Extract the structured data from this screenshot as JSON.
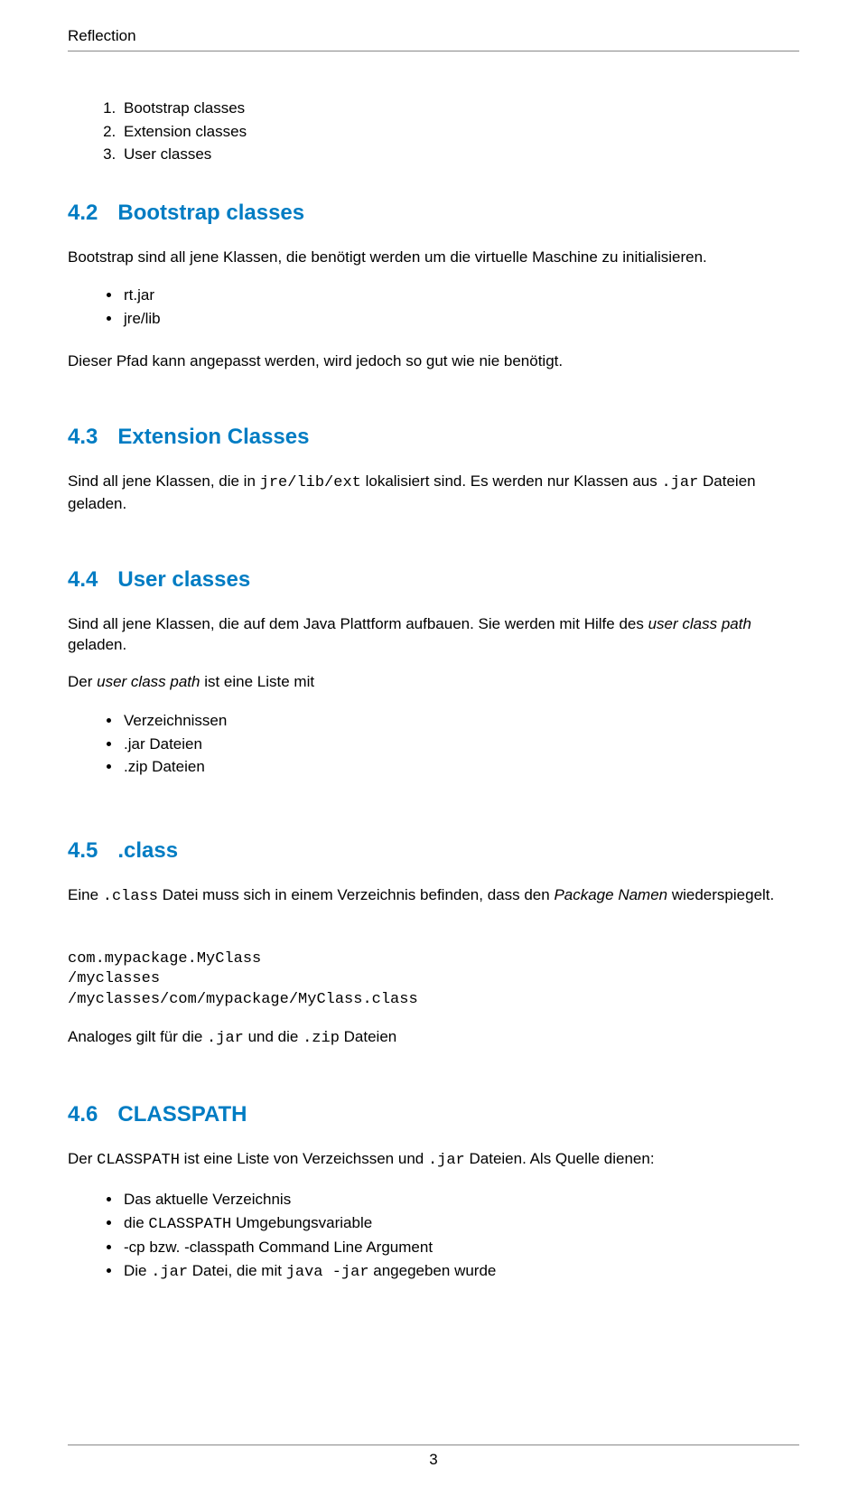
{
  "header": {
    "title": "Reflection"
  },
  "list1": {
    "item1": "Bootstrap classes",
    "item2": "Extension classes",
    "item3": "User classes"
  },
  "sec42": {
    "num": "4.2",
    "title": "Bootstrap classes",
    "p1": "Bootstrap sind all jene Klassen, die benötigt werden um die virtuelle Maschine zu initialisieren.",
    "b1": "rt.jar",
    "b2": "jre/lib",
    "p2": "Dieser Pfad kann angepasst werden, wird jedoch so gut wie nie benötigt."
  },
  "sec43": {
    "num": "4.3",
    "title": "Extension Classes",
    "p1a": "Sind all jene Klassen, die in ",
    "p1code1": "jre/lib/ext",
    "p1b": " lokalisiert sind. Es werden nur Klassen aus ",
    "p1code2": ".jar",
    "p1c": " Dateien geladen."
  },
  "sec44": {
    "num": "4.4",
    "title": "User classes",
    "p1a": "Sind all jene Klassen, die auf dem Java Plattform aufbauen. Sie werden mit Hilfe des ",
    "p1i": "user class path",
    "p1b": " geladen.",
    "p2a": "Der ",
    "p2i": "user class path",
    "p2b": " ist eine Liste mit",
    "b1": "Verzeichnissen",
    "b2": ".jar Dateien",
    "b3": ".zip Dateien"
  },
  "sec45": {
    "num": "4.5",
    "title": ".class",
    "p1a": "Eine ",
    "p1code": ".class",
    "p1b": " Datei muss sich in einem Verzeichnis befinden, dass den ",
    "p1i": "Package Namen",
    "p1c": " wiederspiegelt.",
    "code1": "com.mypackage.MyClass",
    "code2": "/myclasses",
    "code3": "/myclasses/com/mypackage/MyClass.class",
    "p2a": "Analoges gilt für die ",
    "p2code1": ".jar",
    "p2b": " und die ",
    "p2code2": ".zip",
    "p2c": " Dateien"
  },
  "sec46": {
    "num": "4.6",
    "title": "CLASSPATH",
    "p1a": "Der ",
    "p1code1": "CLASSPATH",
    "p1b": " ist eine Liste von Verzeichssen und ",
    "p1code2": ".jar",
    "p1c": " Dateien. Als Quelle dienen:",
    "b1": "Das aktuelle Verzeichnis",
    "b2a": "die ",
    "b2code": "CLASSPATH",
    "b2b": " Umgebungsvariable",
    "b3": "-cp bzw. -classpath Command Line Argument",
    "b4a": "Die ",
    "b4code1": ".jar",
    "b4b": " Datei, die mit ",
    "b4code2": "java -jar",
    "b4c": " angegeben wurde"
  },
  "footer": {
    "pagenum": "3"
  }
}
